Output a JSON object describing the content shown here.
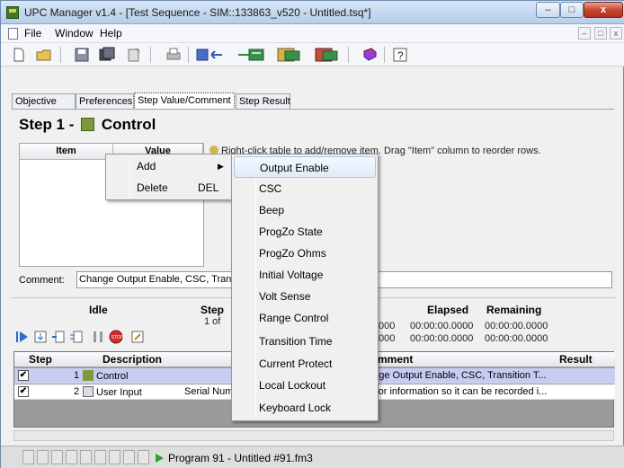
{
  "window": {
    "title": "UPC Manager v1.4 - [Test Sequence - SIM::133863_v520 - Untitled.tsq*]",
    "controls": {
      "minimize": "–",
      "maximize": "□",
      "close": "x"
    }
  },
  "menubar": {
    "items": [
      "File",
      "Window",
      "Help"
    ],
    "mdi_controls": [
      "–",
      "□",
      "x"
    ]
  },
  "toolbar": {
    "icons": [
      "new-icon",
      "open-icon",
      "save-icon",
      "save-all-icon",
      "properties-icon",
      "print-icon",
      "import-icon",
      "export-icon",
      "export-sequence-icon",
      "compile-icon",
      "manual-icon",
      "help-icon"
    ]
  },
  "tabs": [
    "Objective",
    "Preferences",
    "Step Value/Comment",
    "Step Result"
  ],
  "active_tab": "Step Value/Comment",
  "step": {
    "title_prefix": "Step 1 -",
    "title_name": "Control",
    "table_headers": {
      "item": "Item",
      "value": "Value"
    },
    "hint": "Right-click table to add/remove item. Drag \"Item\" column to reorder rows."
  },
  "comment": {
    "label": "Comment:",
    "value": "Change Output Enable, CSC, Transition Time"
  },
  "context_menu": {
    "items": [
      {
        "label": "Add",
        "shortcut": "",
        "submenu_arrow": "▶"
      },
      {
        "label": "Delete",
        "shortcut": "DEL"
      }
    ]
  },
  "add_submenu": {
    "items": [
      "Output Enable",
      "CSC",
      "Beep",
      "ProgZo State",
      "ProgZo Ohms",
      "Initial Voltage",
      "Volt Sense",
      "Range Control",
      "Transition Time",
      "Current Protect",
      "Local Lockout",
      "Keyboard Lock"
    ]
  },
  "status": {
    "state": "Idle",
    "step_label": "Step",
    "step_value": "1 of",
    "elapsed_label": "Elapsed",
    "elapsed_value": "00:00:00.0000",
    "elapsed_left_partial": "000",
    "remaining_label": "Remaining",
    "remaining_value": "00:00:00.0000",
    "remaining_left_partial": "000"
  },
  "grid": {
    "headers": {
      "step": "Step",
      "description": "Description",
      "comment": "mment",
      "result": "Result"
    },
    "rows": [
      {
        "checked": "✔",
        "step": "1",
        "description": "Control",
        "col3": "",
        "comment": "ange Output Enable, CSC, Transition T...",
        "result": ""
      },
      {
        "checked": "✔",
        "step": "2",
        "description": "User Input",
        "col3": "Serial Numb",
        "comment": "k for information so it can be recorded i...",
        "result": ""
      }
    ]
  },
  "statusbar": {
    "text": "Program 91 - Untitled #91.fm3"
  },
  "colors": {
    "selected_row": "#c9ccf2",
    "play_green": "#29a329",
    "title_gradient": "#c4d8f0"
  }
}
